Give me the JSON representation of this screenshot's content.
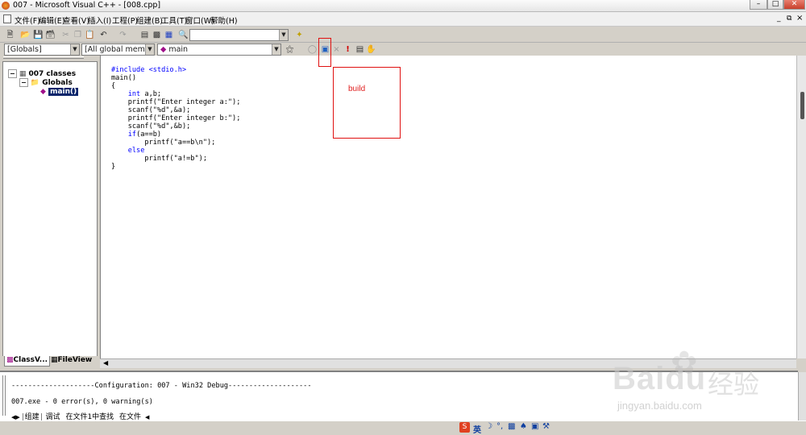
{
  "window": {
    "title": "007 - Microsoft Visual C++ - [008.cpp]"
  },
  "menu": {
    "items": [
      "文件(F)",
      "编辑(E)",
      "查看(V)",
      "插入(I)",
      "工程(P)",
      "组建(B)",
      "工具(T)",
      "窗口(W)",
      "帮助(H)"
    ]
  },
  "toolbar2": {
    "globals_combo": "[Globals]",
    "members_combo": "[All global members",
    "function_combo": "main"
  },
  "classview": {
    "root": "007 classes",
    "globals": "Globals",
    "main_fn": "main()",
    "tabs": [
      "ClassV...",
      "FileView"
    ]
  },
  "code": {
    "lines": [
      "#include <stdio.h>",
      "main()",
      "{",
      "    int a,b;",
      "    printf(\"Enter integer a:\");",
      "    scanf(\"%d\",&a);",
      "    printf(\"Enter integer b:\");",
      "    scanf(\"%d\",&b);",
      "    if(a==b)",
      "        printf(\"a==b\\n\");",
      "    else",
      "        printf(\"a!=b\");",
      "}"
    ]
  },
  "annotation": {
    "label": "build",
    "color": "#e02020"
  },
  "output": {
    "config_line": "--------------------Configuration: 007 - Win32 Debug--------------------",
    "result_line": "007.exe - 0 error(s), 0 warning(s)",
    "tabs": [
      "组建",
      "调试",
      "在文件1中查找",
      "在文件"
    ]
  },
  "statusbar": {
    "ime_label": "英"
  },
  "watermark": {
    "brand": "Baidu",
    "brand_cn": "经验",
    "url": "jingyan.baidu.com"
  }
}
